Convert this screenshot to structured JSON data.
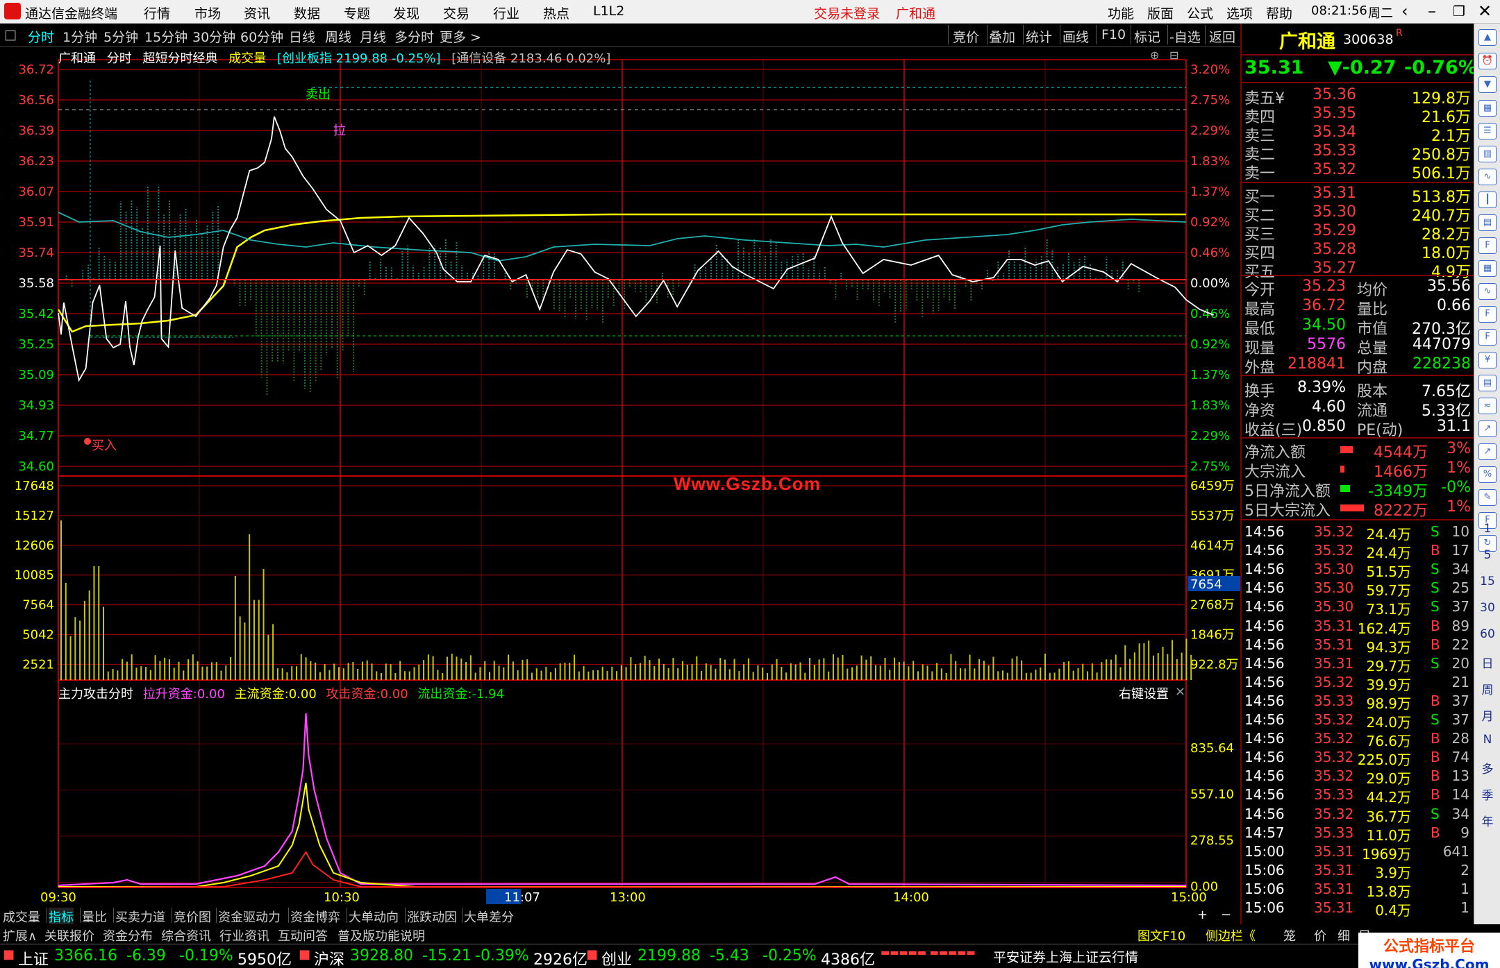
{
  "titlebar": {
    "app_title": "通达信金融终端",
    "menus": [
      "行情",
      "市场",
      "资讯",
      "数据",
      "专题",
      "发现",
      "交易",
      "行业",
      "热点",
      "L1L2"
    ],
    "warn": "交易未登录",
    "stock": "广和通",
    "right_menus": [
      "功能",
      "版面",
      "公式",
      "选项",
      "帮助"
    ],
    "clock": "08:21:56",
    "weekday": "周二"
  },
  "toolbar": {
    "periods": [
      "分时",
      "1分钟",
      "5分钟",
      "15分钟",
      "30分钟",
      "60分钟",
      "日线",
      "周线",
      "月线",
      "多分时",
      "更多 >"
    ],
    "active": "分时",
    "right": [
      "竞价",
      "叠加",
      "统计",
      "画线",
      "F10",
      "标记",
      "-自选",
      "返回"
    ]
  },
  "infobar": {
    "stock": "广和通",
    "mode": "分时",
    "formula": "超短分时经典",
    "vol_label": "成交量",
    "index_ref": "[创业板指 2199.88 -0.25%]",
    "sector_ref": "[通信设备 2183.46 0.02%]"
  },
  "price_axis": {
    "left": [
      "36.72",
      "36.56",
      "36.39",
      "36.23",
      "36.07",
      "35.91",
      "35.74",
      "35.58",
      "35.42",
      "35.25",
      "35.09",
      "34.93",
      "34.77",
      "34.60"
    ],
    "right": [
      "3.20%",
      "2.75%",
      "2.29%",
      "1.83%",
      "1.37%",
      "0.92%",
      "0.46%",
      "0.00%",
      "0.46%",
      "0.92%",
      "1.37%",
      "1.83%",
      "2.29%",
      "2.75%"
    ]
  },
  "vol_axis": {
    "left": [
      "17648",
      "15127",
      "12606",
      "10085",
      "7564",
      "5042",
      "2521"
    ],
    "right": [
      "6459万",
      "5537万",
      "4614万",
      "3691万",
      "2768万",
      "1846万",
      "922.8万"
    ],
    "current": "7654"
  },
  "indicator": {
    "title": "主力攻击分时",
    "items": [
      {
        "label": "拉升资金:",
        "value": "0.00",
        "color": "#ff44ff"
      },
      {
        "label": "主流资金:",
        "value": "0.00",
        "color": "#ffff00"
      },
      {
        "label": "攻击资金:",
        "value": "0.00",
        "color": "#ff3c3c"
      },
      {
        "label": "流出资金:",
        "value": "-1.94",
        "color": "#00e600"
      }
    ],
    "setting": "右键设置",
    "axis": [
      "835.64",
      "557.10",
      "278.55",
      "0.00"
    ]
  },
  "time_axis": [
    "09:30",
    "10:30",
    "11:07",
    "13:00",
    "14:00",
    "15:00"
  ],
  "markers": {
    "buy": "买入",
    "sell": "卖出",
    "pull": "拉"
  },
  "watermark": "Www.Gszb.Com",
  "quote": {
    "name": "广和通",
    "code": "300638",
    "badge": "R",
    "price": "35.31",
    "change": "▼-0.27",
    "pct": "-0.76%",
    "asks": [
      {
        "label": "卖五",
        "flag": "¥",
        "price": "35.36",
        "vol": "129.8万"
      },
      {
        "label": "卖四",
        "flag": "",
        "price": "35.35",
        "vol": "21.6万"
      },
      {
        "label": "卖三",
        "flag": "",
        "price": "35.34",
        "vol": "2.1万"
      },
      {
        "label": "卖二",
        "flag": "",
        "price": "35.33",
        "vol": "250.8万"
      },
      {
        "label": "卖一",
        "flag": "",
        "price": "35.32",
        "vol": "506.1万"
      }
    ],
    "bids": [
      {
        "label": "买一",
        "price": "35.31",
        "vol": "513.8万"
      },
      {
        "label": "买二",
        "price": "35.30",
        "vol": "240.7万"
      },
      {
        "label": "买三",
        "price": "35.29",
        "vol": "28.2万"
      },
      {
        "label": "买四",
        "price": "35.28",
        "vol": "18.0万"
      },
      {
        "label": "买五",
        "price": "35.27",
        "vol": "4.9万"
      }
    ],
    "stats": [
      {
        "l1": "今开",
        "v1": "35.23",
        "c1": "red",
        "l2": "均价",
        "v2": "35.56",
        "c2": "white"
      },
      {
        "l1": "最高",
        "v1": "36.72",
        "c1": "red",
        "l2": "量比",
        "v2": "0.66",
        "c2": "white"
      },
      {
        "l1": "最低",
        "v1": "34.50",
        "c1": "green",
        "l2": "市值",
        "v2": "270.3亿",
        "c2": "white"
      },
      {
        "l1": "现量",
        "v1": "5576",
        "c1": "magenta",
        "l2": "总量",
        "v2": "447079",
        "c2": "white"
      },
      {
        "l1": "外盘",
        "v1": "218841",
        "c1": "red",
        "l2": "内盘",
        "v2": "228238",
        "c2": "green"
      }
    ],
    "stats2": [
      {
        "l1": "换手",
        "v1": "8.39%",
        "l2": "股本",
        "v2": "7.65亿"
      },
      {
        "l1": "净资",
        "v1": "4.60",
        "l2": "流通",
        "v2": "5.33亿"
      },
      {
        "l1": "收益(三)",
        "v1": "0.850",
        "l2": "PE(动)",
        "v2": "31.1"
      }
    ],
    "flows": [
      {
        "label": "净流入额",
        "value": "4544万",
        "pct": "3%",
        "color": "red",
        "bar": "red"
      },
      {
        "label": "大宗流入",
        "value": "1466万",
        "pct": "1%",
        "color": "red",
        "bar": "red"
      },
      {
        "label": "5日净流入额",
        "value": "-3349万",
        "pct": "-0%",
        "color": "green",
        "bar": "green"
      },
      {
        "label": "5日大宗流入",
        "value": "8222万",
        "pct": "1%",
        "color": "red",
        "bar": "red"
      }
    ],
    "ticks": [
      {
        "t": "14:56",
        "p": "35.32",
        "v": "24.4万",
        "d": "S",
        "n": "10"
      },
      {
        "t": "14:56",
        "p": "35.32",
        "v": "24.4万",
        "d": "B",
        "n": "17"
      },
      {
        "t": "14:56",
        "p": "35.30",
        "v": "51.5万",
        "d": "S",
        "n": "34"
      },
      {
        "t": "14:56",
        "p": "35.30",
        "v": "59.7万",
        "d": "S",
        "n": "25"
      },
      {
        "t": "14:56",
        "p": "35.30",
        "v": "73.1万",
        "d": "S",
        "n": "37"
      },
      {
        "t": "14:56",
        "p": "35.31",
        "v": "162.4万",
        "d": "B",
        "n": "89"
      },
      {
        "t": "14:56",
        "p": "35.31",
        "v": "94.3万",
        "d": "B",
        "n": "22"
      },
      {
        "t": "14:56",
        "p": "35.31",
        "v": "29.7万",
        "d": "S",
        "n": "20"
      },
      {
        "t": "14:56",
        "p": "35.32",
        "v": "39.9万",
        "d": "",
        "n": "21"
      },
      {
        "t": "14:56",
        "p": "35.33",
        "v": "98.9万",
        "d": "B",
        "n": "37"
      },
      {
        "t": "14:56",
        "p": "35.32",
        "v": "24.0万",
        "d": "S",
        "n": "37"
      },
      {
        "t": "14:56",
        "p": "35.32",
        "v": "76.6万",
        "d": "B",
        "n": "28"
      },
      {
        "t": "14:56",
        "p": "35.32",
        "v": "225.0万",
        "d": "B",
        "n": "74"
      },
      {
        "t": "14:56",
        "p": "35.32",
        "v": "29.0万",
        "d": "B",
        "n": "13"
      },
      {
        "t": "14:56",
        "p": "35.33",
        "v": "44.2万",
        "d": "B",
        "n": "14"
      },
      {
        "t": "14:56",
        "p": "35.32",
        "v": "36.7万",
        "d": "S",
        "n": "34"
      },
      {
        "t": "14:57",
        "p": "35.33",
        "v": "11.0万",
        "d": "B",
        "n": "9"
      },
      {
        "t": "15:00",
        "p": "35.31",
        "v": "1969万",
        "d": "",
        "n": "641"
      },
      {
        "t": "15:06",
        "p": "35.31",
        "v": "3.9万",
        "d": "",
        "n": "2"
      },
      {
        "t": "15:06",
        "p": "35.31",
        "v": "13.8万",
        "d": "",
        "n": "1"
      },
      {
        "t": "15:06",
        "p": "35.31",
        "v": "0.4万",
        "d": "",
        "n": "1"
      }
    ]
  },
  "side_texts": [
    "1",
    "5",
    "15",
    "30",
    "60",
    "日",
    "周",
    "月",
    "N",
    "多",
    "季",
    "年"
  ],
  "bottom_tabs": [
    "成交量",
    "指标",
    "量比",
    "买卖力道",
    "竞价图",
    "资金驱动力",
    "资金博弈",
    "大单动向",
    "涨跌动因",
    "大单差分"
  ],
  "bottom_tabs_active": "指标",
  "bottom_tabs2": [
    "扩展∧",
    "关联报价",
    "资金分布",
    "综合资讯",
    "行业资讯",
    "互动问答",
    "普及版功能说明"
  ],
  "bottom_tabs2_right": [
    "图文F10",
    "侧边栏《",
    "笼",
    "价",
    "细",
    "目"
  ],
  "statusbar": [
    {
      "name": "上证",
      "value": "3366.16",
      "chg": "-6.39",
      "pct": "-0.19%",
      "amt": "5950亿"
    },
    {
      "name": "沪深",
      "value": "3928.80",
      "chg": "-15.21",
      "pct": "-0.39%",
      "amt": "2926亿"
    },
    {
      "name": "创业",
      "value": "2199.88",
      "chg": "-5.43",
      "pct": "-0.25%",
      "amt": "4386亿"
    }
  ],
  "status_right": "平安证券上海上证云行情",
  "bottom_watermark": {
    "l1": "公式指标平台",
    "l2": "www.Gszb.Com"
  }
}
